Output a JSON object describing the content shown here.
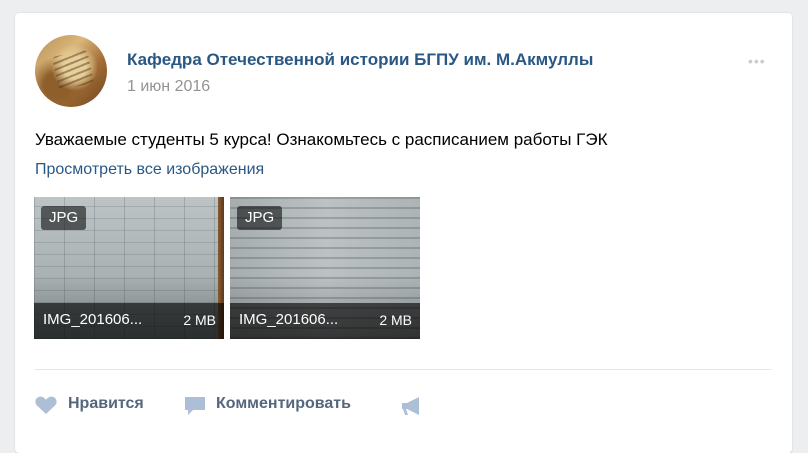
{
  "post": {
    "author": "Кафедра Отечественной истории БГПУ им. М.Акмуллы",
    "date": "1 июн 2016",
    "more_label": "•••",
    "text": "Уважаемые студенты 5 курса! Ознакомьтесь с расписанием работы ГЭК",
    "show_all_label": "Просмотреть все изображения",
    "attachments": [
      {
        "type_badge": "JPG",
        "name": "IMG_201606...",
        "size": "2 MB"
      },
      {
        "type_badge": "JPG",
        "name": "IMG_201606...",
        "size": "2 MB"
      }
    ]
  },
  "actions": {
    "like_label": "Нравится",
    "comment_label": "Комментировать",
    "like_icon": "heart-icon",
    "comment_icon": "comment-icon",
    "share_icon": "megaphone-icon"
  },
  "colors": {
    "link": "#2a5885",
    "muted": "#939393",
    "action": "#55677d",
    "icon": "#adbfd6",
    "background": "#edeef0"
  }
}
